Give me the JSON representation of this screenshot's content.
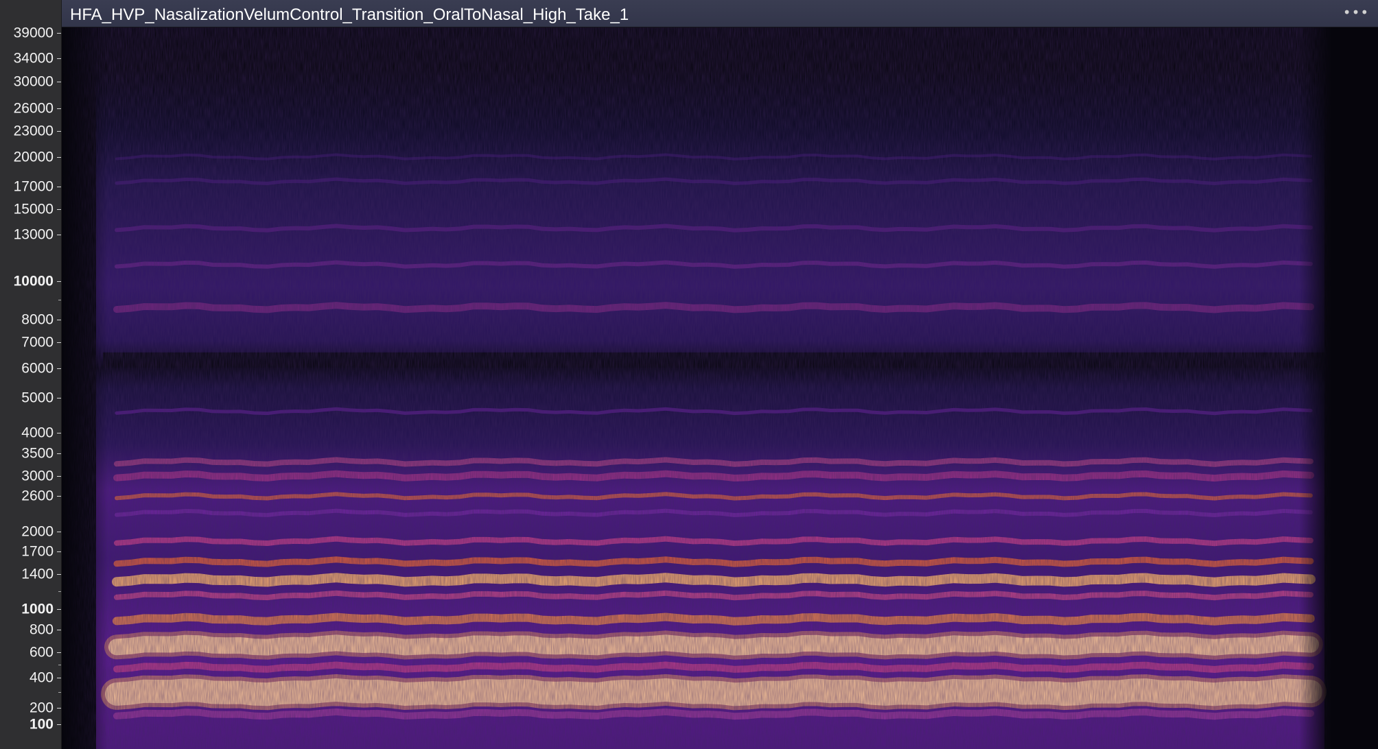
{
  "track": {
    "title": "HFA_HVP_NasalizationVelumControl_Transition_OralToNasal_High_Take_1",
    "menu_label": "•••"
  },
  "frequency_axis": {
    "labels": [
      {
        "text": "39000",
        "hz": 39000,
        "bold": false
      },
      {
        "text": "34000",
        "hz": 34000,
        "bold": false
      },
      {
        "text": "30000",
        "hz": 30000,
        "bold": false
      },
      {
        "text": "26000",
        "hz": 26000,
        "bold": false
      },
      {
        "text": "23000",
        "hz": 23000,
        "bold": false
      },
      {
        "text": "20000",
        "hz": 20000,
        "bold": false
      },
      {
        "text": "17000",
        "hz": 17000,
        "bold": false
      },
      {
        "text": "15000",
        "hz": 15000,
        "bold": false
      },
      {
        "text": "13000",
        "hz": 13000,
        "bold": false
      },
      {
        "text": "10000",
        "hz": 10000,
        "bold": true
      },
      {
        "text": "8000",
        "hz": 8000,
        "bold": false
      },
      {
        "text": "7000",
        "hz": 7000,
        "bold": false
      },
      {
        "text": "6000",
        "hz": 6000,
        "bold": false
      },
      {
        "text": "5000",
        "hz": 5000,
        "bold": false
      },
      {
        "text": "4000",
        "hz": 4000,
        "bold": false
      },
      {
        "text": "3500",
        "hz": 3500,
        "bold": false
      },
      {
        "text": "3000",
        "hz": 3000,
        "bold": false
      },
      {
        "text": "2600",
        "hz": 2600,
        "bold": false
      },
      {
        "text": "2000",
        "hz": 2000,
        "bold": false
      },
      {
        "text": "1700",
        "hz": 1700,
        "bold": false
      },
      {
        "text": "1400",
        "hz": 1400,
        "bold": false
      },
      {
        "text": "1000",
        "hz": 1000,
        "bold": true
      },
      {
        "text": "800",
        "hz": 800,
        "bold": false
      },
      {
        "text": "600",
        "hz": 600,
        "bold": false
      },
      {
        "text": "400",
        "hz": 400,
        "bold": false
      },
      {
        "text": "200",
        "hz": 200,
        "bold": false
      },
      {
        "text": "100",
        "hz": 100,
        "bold": true
      }
    ],
    "scale": "mel-like"
  },
  "colors": {
    "background": "#06050c",
    "low": "#1a1040",
    "mid": "#6a1fa8",
    "high": "#e0582e",
    "peak": "#fff6e6"
  }
}
